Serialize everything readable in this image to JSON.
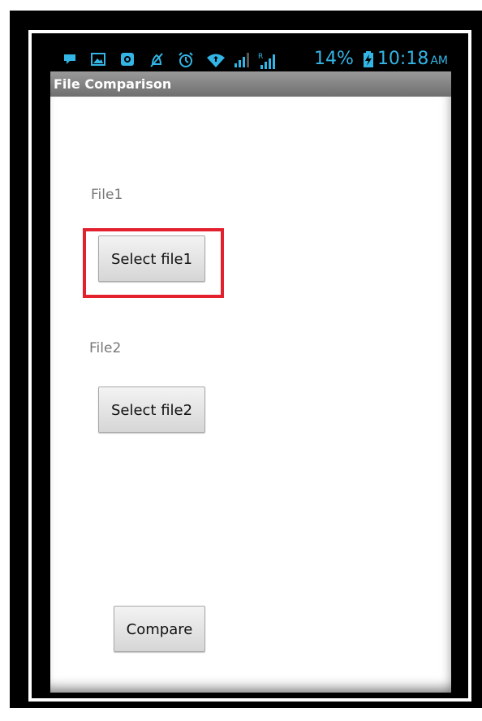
{
  "status_bar": {
    "icons": [
      "notification-icon",
      "image-icon",
      "app-icon",
      "mute-icon",
      "alarm-icon",
      "wifi-icon",
      "signal-icon",
      "roaming-signal-icon"
    ],
    "battery": "14%",
    "time": "10:18",
    "ampm": "AM",
    "accent_color": "#33b5e5"
  },
  "app": {
    "title": "File Comparison"
  },
  "form": {
    "file1_label": "File1",
    "file1_button": "Select file1",
    "file2_label": "File2",
    "file2_button": "Select file2",
    "compare_button": "Compare"
  },
  "highlight_color": "#e3202e"
}
